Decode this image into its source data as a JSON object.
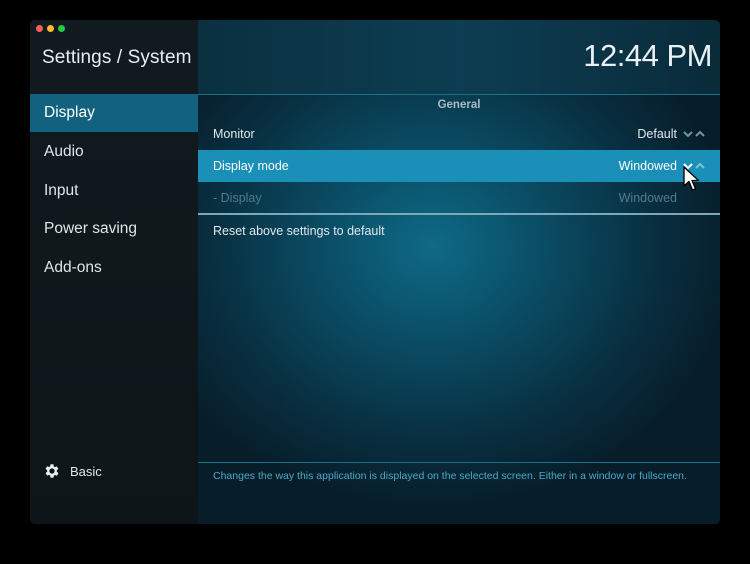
{
  "header": {
    "title": "Settings / System",
    "clock": "12:44 PM"
  },
  "sidebar": {
    "items": [
      {
        "label": "Display",
        "active": true
      },
      {
        "label": "Audio"
      },
      {
        "label": "Input"
      },
      {
        "label": "Power saving"
      },
      {
        "label": "Add-ons"
      }
    ],
    "level": {
      "label": "Basic",
      "icon": "gear-icon"
    }
  },
  "main": {
    "section": "General",
    "rows": [
      {
        "label": "Monitor",
        "value": "Default"
      },
      {
        "label": "Display mode",
        "value": "Windowed"
      },
      {
        "label": "- Display",
        "value": "Windowed"
      }
    ],
    "reset_label": "Reset above settings to default",
    "help_text": "Changes the way this application is displayed on the selected screen. Either in a window or fullscreen."
  },
  "colors": {
    "accent": "#1a8fb8",
    "sidebar_active": "#12627f",
    "help_text": "#4ba8c7"
  }
}
